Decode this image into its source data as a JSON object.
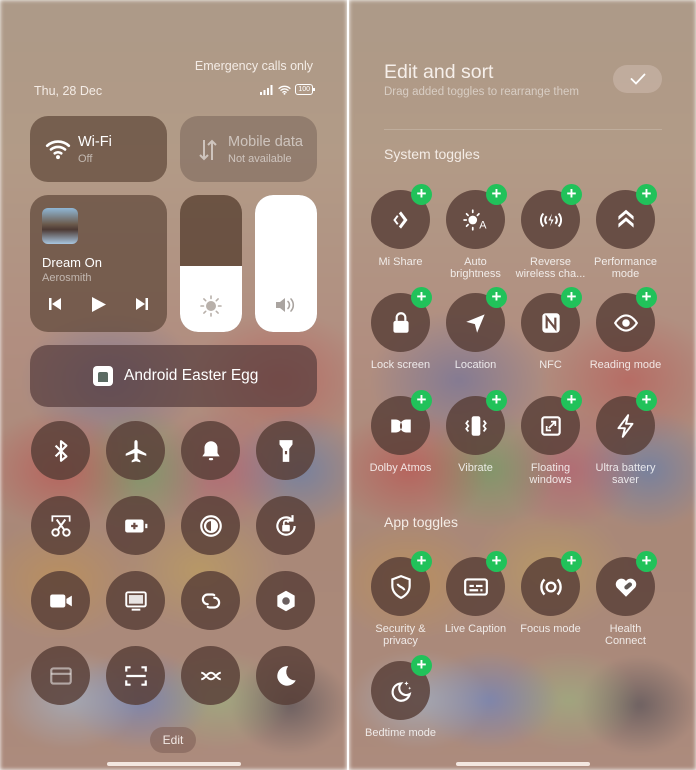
{
  "left": {
    "status": {
      "carrier_text": "Emergency calls only",
      "date": "Thu, 28 Dec",
      "battery": "100"
    },
    "wifi": {
      "title": "Wi-Fi",
      "status": "Off"
    },
    "mobile_data": {
      "title": "Mobile data",
      "status": "Not available"
    },
    "media": {
      "title": "Dream On",
      "artist": "Aerosmith"
    },
    "brightness_level_pct": 48,
    "volume_level_pct": 100,
    "easter_egg": {
      "label": "Android Easter Egg"
    },
    "toggles": [
      {
        "name": "bluetooth",
        "icon": "bluetooth-icon"
      },
      {
        "name": "airplane-mode",
        "icon": "airplane-icon"
      },
      {
        "name": "sound",
        "icon": "bell-icon"
      },
      {
        "name": "flashlight",
        "icon": "flashlight-icon"
      },
      {
        "name": "screenshot",
        "icon": "scissors-icon"
      },
      {
        "name": "battery-saver",
        "icon": "battery-plus-icon"
      },
      {
        "name": "dark-mode",
        "icon": "contrast-icon"
      },
      {
        "name": "rotation-lock",
        "icon": "rotate-lock-icon"
      },
      {
        "name": "screen-recorder",
        "icon": "video-camera-icon"
      },
      {
        "name": "cast",
        "icon": "monitor-icon"
      },
      {
        "name": "link",
        "icon": "link-icon"
      },
      {
        "name": "settings-nut",
        "icon": "hexagon-nut-icon"
      },
      {
        "name": "card",
        "icon": "card-icon"
      },
      {
        "name": "scanner",
        "icon": "scan-icon"
      },
      {
        "name": "data-saver",
        "icon": "cross-wave-icon"
      },
      {
        "name": "do-not-disturb",
        "icon": "moon-icon"
      }
    ],
    "edit_label": "Edit"
  },
  "right": {
    "title": "Edit and sort",
    "subtitle": "Drag added toggles to rearrange them",
    "system_section": "System toggles",
    "app_section": "App toggles",
    "add_symbol": "+",
    "system_toggles": [
      {
        "label": "Mi Share",
        "icon": "mi-share-icon"
      },
      {
        "label": "Auto brightness",
        "icon": "auto-brightness-icon"
      },
      {
        "label": "Reverse wireless cha...",
        "icon": "reverse-charging-icon"
      },
      {
        "label": "Performance mode",
        "icon": "double-chevron-up-icon"
      },
      {
        "label": "Lock screen",
        "icon": "lock-icon"
      },
      {
        "label": "Location",
        "icon": "location-arrow-icon"
      },
      {
        "label": "NFC",
        "icon": "nfc-icon"
      },
      {
        "label": "Reading mode",
        "icon": "eye-icon"
      },
      {
        "label": "Dolby Atmos",
        "icon": "dolby-icon"
      },
      {
        "label": "Vibrate",
        "icon": "vibrate-icon"
      },
      {
        "label": "Floating windows",
        "icon": "floating-window-icon"
      },
      {
        "label": "Ultra battery saver",
        "icon": "lightning-icon"
      }
    ],
    "app_toggles": [
      {
        "label": "Security & privacy",
        "icon": "shield-icon"
      },
      {
        "label": "Live Caption",
        "icon": "caption-icon"
      },
      {
        "label": "Focus mode",
        "icon": "focus-icon"
      },
      {
        "label": "Health Connect",
        "icon": "health-heart-icon"
      },
      {
        "label": "Bedtime mode",
        "icon": "bedtime-moon-icon"
      }
    ]
  }
}
